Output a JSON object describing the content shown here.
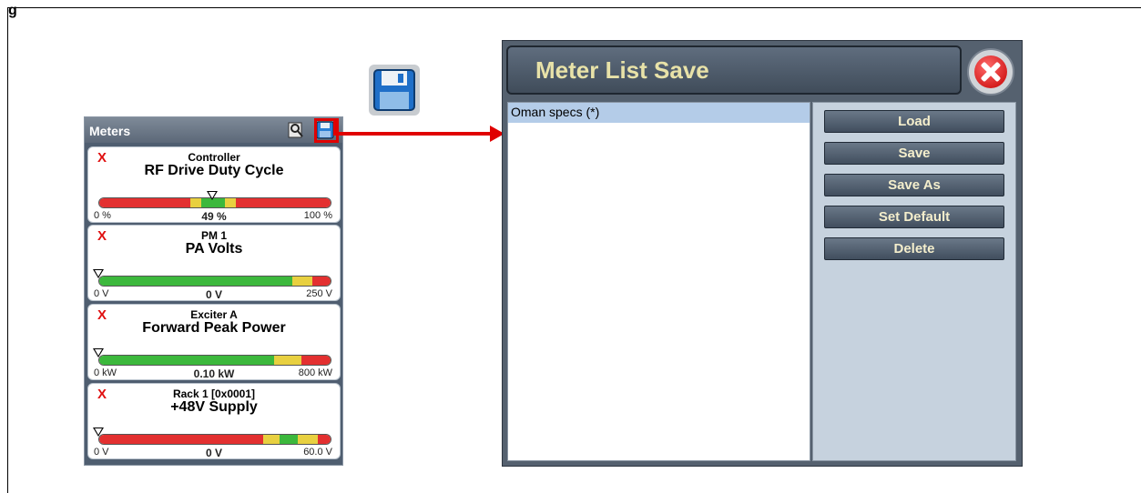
{
  "figure": {
    "label": "g"
  },
  "meters_panel": {
    "title": "Meters",
    "meters": [
      {
        "remove": "X",
        "device": "Controller",
        "name": "RF Drive Duty Cycle",
        "min": "0 %",
        "value": "49 %",
        "max": "100 %",
        "level": 0.49
      },
      {
        "remove": "X",
        "device": "PM 1",
        "name": "PA Volts",
        "min": "0 V",
        "value": "0 V",
        "max": "250 V",
        "level": 0.0
      },
      {
        "remove": "X",
        "device": "Exciter A",
        "name": "Forward Peak Power",
        "min": "0 kW",
        "value": "0.10 kW",
        "max": "800 kW",
        "level": 0.0
      },
      {
        "remove": "X",
        "device": "Rack 1 [0x0001]",
        "name": "+48V Supply",
        "min": "0 V",
        "value": "0 V",
        "max": "60.0 V",
        "level": 0.0
      }
    ]
  },
  "dialog": {
    "title": "Meter List Save",
    "list_items": [
      "Oman specs (*)"
    ],
    "buttons": {
      "load": "Load",
      "save": "Save",
      "save_as": "Save As",
      "set_default": "Set Default",
      "delete": "Delete"
    }
  },
  "colors": {
    "red_zone": "#e33030",
    "yellow_zone": "#e8d040",
    "green_zone": "#3cb83c",
    "highlight": "#e00000"
  }
}
